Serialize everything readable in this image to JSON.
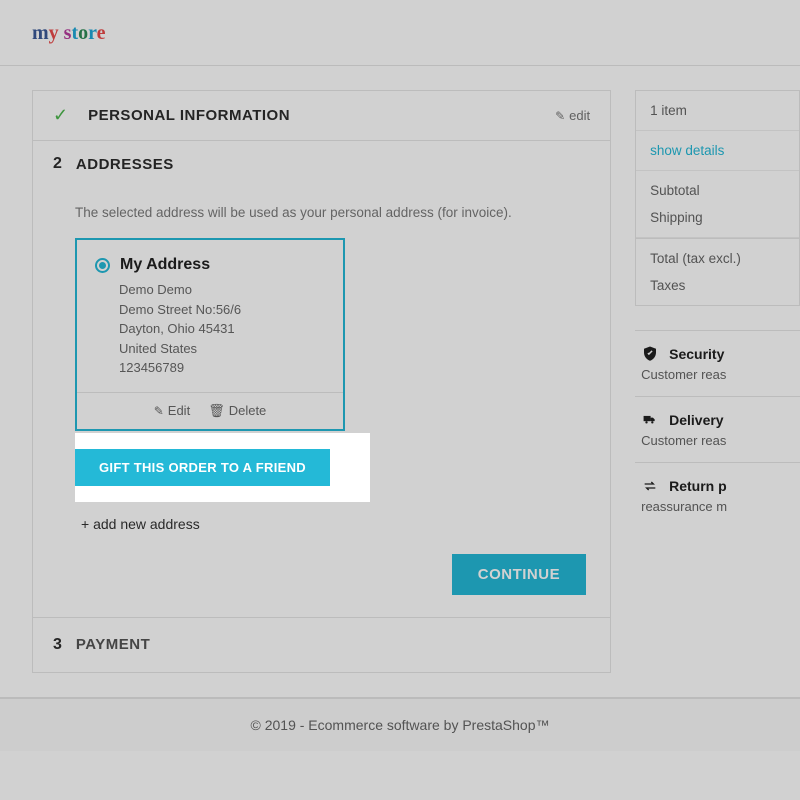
{
  "logo": {
    "m": "m",
    "y": "y",
    "space": " ",
    "s": "s",
    "t": "t",
    "o": "o",
    "r": "r",
    "e": "e"
  },
  "steps": {
    "s1": {
      "title": "PERSONAL INFORMATION",
      "edit": "edit"
    },
    "s2": {
      "num": "2",
      "title": "ADDRESSES",
      "help": "The selected address will be used as your personal address (for invoice).",
      "address": {
        "label": "My Address",
        "line1": "Demo Demo",
        "line2": "Demo Street No:56/6",
        "line3": "Dayton, Ohio 45431",
        "line4": "United States",
        "line5": "123456789",
        "edit": "Edit",
        "delete": "Delete"
      },
      "gift_btn": "GIFT THIS ORDER TO A FRIEND",
      "add_new": "+ add new address",
      "continue": "CONTINUE"
    },
    "s3": {
      "num": "3",
      "title": "PAYMENT"
    }
  },
  "sidebar": {
    "items": "1 item",
    "show_details": "show details",
    "subtotal": "Subtotal",
    "shipping": "Shipping",
    "total": "Total (tax excl.)",
    "taxes": "Taxes",
    "reassurance": [
      {
        "icon": "shield",
        "title": "Security",
        "sub": "Customer reas"
      },
      {
        "icon": "truck",
        "title": "Delivery",
        "sub": "Customer reas"
      },
      {
        "icon": "swap",
        "title": "Return p",
        "sub": "reassurance m"
      }
    ]
  },
  "footer": "© 2019 - Ecommerce software by PrestaShop™"
}
